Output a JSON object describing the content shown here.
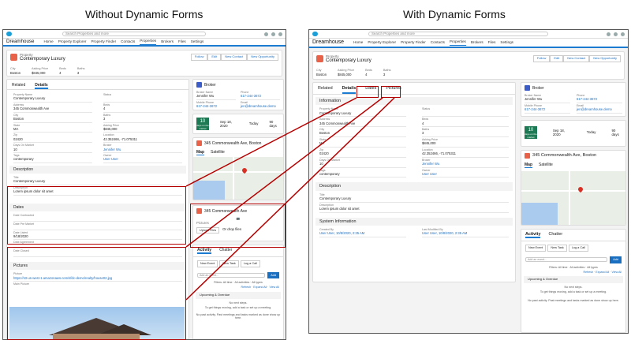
{
  "captions": {
    "left": "Without Dynamic Forms",
    "right": "With Dynamic Forms"
  },
  "app": {
    "name": "Dreamhouse",
    "search_placeholder": "Search Properties and more",
    "nav": [
      "Home",
      "Property Explorer",
      "Property Finder",
      "Contacts",
      "Properties",
      "Brokers",
      "Files",
      "Settings"
    ]
  },
  "record": {
    "type": "Property",
    "name": "Contemporary Luxury",
    "actions": [
      "Follow",
      "Edit",
      "New Contact",
      "New Opportunity"
    ],
    "highlights": [
      {
        "label": "City",
        "value": "Boston"
      },
      {
        "label": "Asking Price",
        "value": "$845,000"
      },
      {
        "label": "Beds",
        "value": "4"
      },
      {
        "label": "Baths",
        "value": "3"
      }
    ]
  },
  "left": {
    "tabs": [
      "Related",
      "Details"
    ],
    "fields": [
      {
        "label": "Property Name",
        "value": "Contemporary Luxury"
      },
      {
        "label": "Status",
        "value": ""
      },
      {
        "label": "Address",
        "value": "345 Commonwealth Ave"
      },
      {
        "label": "Beds",
        "value": "4"
      },
      {
        "label": "City",
        "value": "Boston"
      },
      {
        "label": "Baths",
        "value": "3"
      },
      {
        "label": "State",
        "value": "MA"
      },
      {
        "label": "Asking Price",
        "value": "$845,000"
      },
      {
        "label": "Zip",
        "value": "02420"
      },
      {
        "label": "Location",
        "value": "42.352466, -71.075311"
      },
      {
        "label": "Days On Market",
        "value": "10"
      },
      {
        "label": "Broker",
        "value": "Jennifer Wu"
      },
      {
        "label": "Tags",
        "value": "contemporary"
      },
      {
        "label": "Owner",
        "value": "User User"
      }
    ],
    "description_header": "Description",
    "description_fields": [
      {
        "label": "Title",
        "value": "Contemporary Luxury"
      },
      {
        "label": "Description",
        "value": "Lorem ipsum dolor sit amet"
      }
    ],
    "dates_header": "Dates",
    "dates_fields": [
      "Date Contracted",
      "Date Pre Market",
      "Date Listed",
      "Date Agreement",
      "Date Closed"
    ],
    "date_listed_value": "9/18/2020",
    "pictures_header": "Pictures",
    "picture_label": "Picture",
    "picture_url": "https://s3-us-west-1.amazonaws.com/sfdc-demo/realty/house02.jpg",
    "main_picture_label": "Main Picture",
    "files_title": "345 Commonwealth Ave",
    "files_hint": "Pictures",
    "upload_label": "Upload Files",
    "drop_label": "Or drop files"
  },
  "right": {
    "tabs": [
      "Related",
      "Details",
      "Dates",
      "Pictures"
    ],
    "info_header": "Information",
    "fields": [
      {
        "label": "Property Name",
        "value": "Contemporary Luxury"
      },
      {
        "label": "Status",
        "value": ""
      },
      {
        "label": "Address",
        "value": "345 Commonwealth Ave"
      },
      {
        "label": "Beds",
        "value": "4"
      },
      {
        "label": "City",
        "value": "Boston"
      },
      {
        "label": "Baths",
        "value": "3"
      },
      {
        "label": "State",
        "value": "MA"
      },
      {
        "label": "Asking Price",
        "value": "$845,000"
      },
      {
        "label": "Zip",
        "value": "02420"
      },
      {
        "label": "Location",
        "value": "42.352466, -71.075311"
      },
      {
        "label": "Days On Market",
        "value": "10"
      },
      {
        "label": "Broker",
        "value": "Jennifer Wu"
      },
      {
        "label": "Tags",
        "value": "contemporary"
      },
      {
        "label": "Owner",
        "value": "User User"
      }
    ],
    "description_header": "Description",
    "description_fields": [
      {
        "label": "Title",
        "value": "Contemporary Luxury"
      },
      {
        "label": "Description",
        "value": "Lorem ipsum dolor sit amet"
      }
    ],
    "system_header": "System Information",
    "system_fields": [
      {
        "label": "Created By",
        "value": "User User, 10/8/2020, 2:35 AM"
      },
      {
        "label": "Last Modified By",
        "value": "User User, 10/8/2020, 2:35 AM"
      }
    ]
  },
  "broker": {
    "title": "Broker",
    "name_label": "Broker Name",
    "name": "Jennifer Wu",
    "phone_label": "Phone",
    "phone": "617-244-3672",
    "mobile_label": "Mobile Phone",
    "mobile": "617-244-3672",
    "email_label": "Email",
    "email": "jen@dreamhouse.demo"
  },
  "days": {
    "number": "10",
    "unit": "days on the market",
    "date": "Sep 18, 2020",
    "today": "Today",
    "end": "90 days"
  },
  "map": {
    "title": "345 Commonwealth Ave, Boston",
    "tabs": [
      "Map",
      "Satellite"
    ]
  },
  "chatter": {
    "tabs": [
      "Activity",
      "Chatter"
    ],
    "buttons": [
      "New Event",
      "New Task",
      "Log a Call"
    ],
    "input_placeholder": "Add an event...",
    "add_label": "Add",
    "filters": "Filters: All time · All activities · All types",
    "links": "Refresh · Expand All · View All",
    "upcoming": "Upcoming & Overdue",
    "no_steps": "No next steps.",
    "no_steps_hint": "To get things moving, add a task or set up a meeting.",
    "no_past": "No past activity. Past meetings and tasks marked as done show up here."
  },
  "colors": {
    "annotation": "#b40000",
    "brand": "#1b7bd0",
    "record_icon": "#e8624a",
    "days_badge": "#1d7a55"
  }
}
